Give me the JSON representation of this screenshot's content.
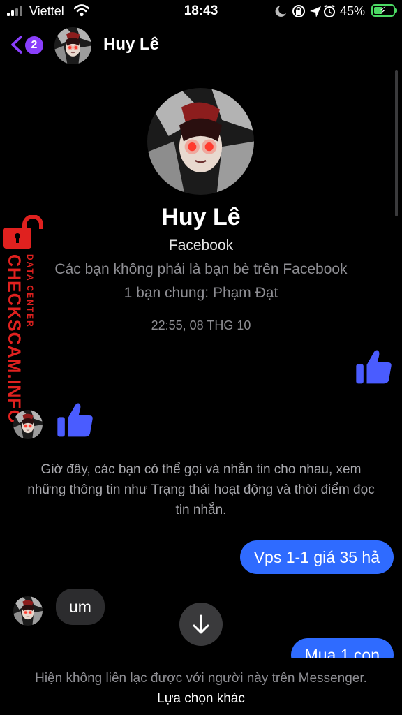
{
  "status_bar": {
    "carrier": "Viettel",
    "time": "18:43",
    "battery_percent": "45%"
  },
  "header": {
    "unread_count": "2",
    "name": "Huy Lê"
  },
  "profile": {
    "name": "Huy Lê",
    "subtitle": "Facebook",
    "friend_status": "Các bạn không phải là bạn bè trên Facebook",
    "mutual_friends": "1 bạn chung: Phạm Đạt"
  },
  "conversation": {
    "timestamp": "22:55, 08 THG 10",
    "system_note": "Giờ đây, các bạn có thể gọi và nhắn tin cho nhau, xem những thông tin như Trạng thái hoạt động và thời điểm đọc tin nhắn.",
    "messages": [
      {
        "from": "me",
        "type": "like"
      },
      {
        "from": "them",
        "type": "like"
      },
      {
        "from": "me",
        "type": "text",
        "text": "Vps 1-1 giá 35 hả"
      },
      {
        "from": "them",
        "type": "text",
        "text": "um"
      },
      {
        "from": "me",
        "type": "text",
        "text": "Mua 1 con"
      }
    ]
  },
  "footer": {
    "notice": "Hiện không liên lạc được với người này trên Messenger.",
    "link": "Lựa chọn khác"
  },
  "watermark": {
    "brand": "CHECKSCAM.INFO",
    "sub": "DATA CENTER"
  },
  "colors": {
    "accent_purple": "#8a3ffc",
    "bubble_blue": "#2f6bff",
    "like_blue": "#4a5cff",
    "watermark_red": "#e0211f",
    "battery_green": "#4cd964"
  },
  "icons": [
    "back-chevron-icon",
    "wifi-icon",
    "moon-icon",
    "lock-rotation-icon",
    "location-icon",
    "alarm-icon",
    "like-icon",
    "arrow-down-icon",
    "lock-icon"
  ]
}
